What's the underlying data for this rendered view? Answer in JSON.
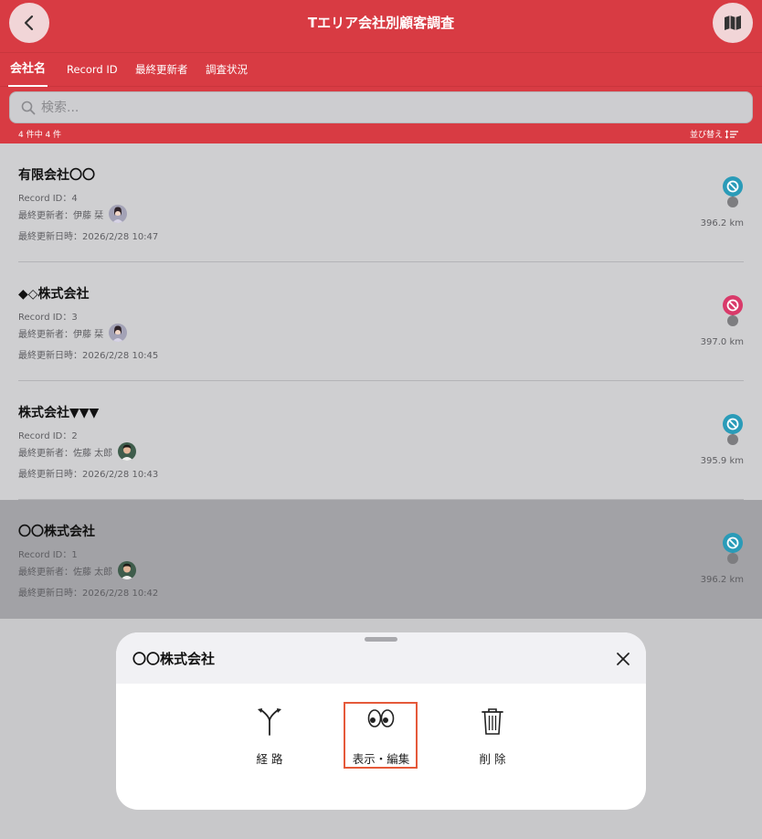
{
  "header": {
    "title": "Tエリア会社別顧客調査",
    "back_icon": "chevron-left-icon",
    "map_icon": "map-icon"
  },
  "tabs": [
    {
      "label": "会社名",
      "active": true
    },
    {
      "label": "Record ID",
      "active": false
    },
    {
      "label": "最終更新者",
      "active": false
    },
    {
      "label": "調査状況",
      "active": false
    }
  ],
  "search": {
    "placeholder": "検索..."
  },
  "list_info": {
    "count": "4 件中 4 件",
    "sort_label": "並び替え"
  },
  "records": [
    {
      "name": "有限会社〇〇",
      "record_id": "Record ID：4",
      "updater": "最終更新者：伊藤 栞",
      "updated_at": "最終更新日時：2026/2/28 10:47",
      "distance": "396.2 km",
      "pin_color": "#2a9bb8",
      "avatar": "female"
    },
    {
      "name": "◆◇株式会社",
      "record_id": "Record ID：3",
      "updater": "最終更新者：伊藤 栞",
      "updated_at": "最終更新日時：2026/2/28 10:45",
      "distance": "397.0 km",
      "pin_color": "#d93a6a",
      "avatar": "female"
    },
    {
      "name": "株式会社▼▼▼",
      "record_id": "Record ID：2",
      "updater": "最終更新者：佐藤 太郎",
      "updated_at": "最終更新日時：2026/2/28 10:43",
      "distance": "395.9 km",
      "pin_color": "#2a9bb8",
      "avatar": "male"
    },
    {
      "name": "〇〇株式会社",
      "record_id": "Record ID：1",
      "updater": "最終更新者：佐藤 太郎",
      "updated_at": "最終更新日時：2026/2/28 10:42",
      "distance": "396.2 km",
      "pin_color": "#2a9bb8",
      "avatar": "male",
      "selected": true
    }
  ],
  "sheet": {
    "title": "〇〇株式会社",
    "actions": [
      {
        "label": "経 路",
        "icon": "route-icon"
      },
      {
        "label": "表示・編集",
        "icon": "eyes-icon",
        "highlighted": true
      },
      {
        "label": "削 除",
        "icon": "trash-icon"
      }
    ]
  },
  "colors": {
    "header": "#d83b43",
    "highlight": "#e5593a"
  }
}
